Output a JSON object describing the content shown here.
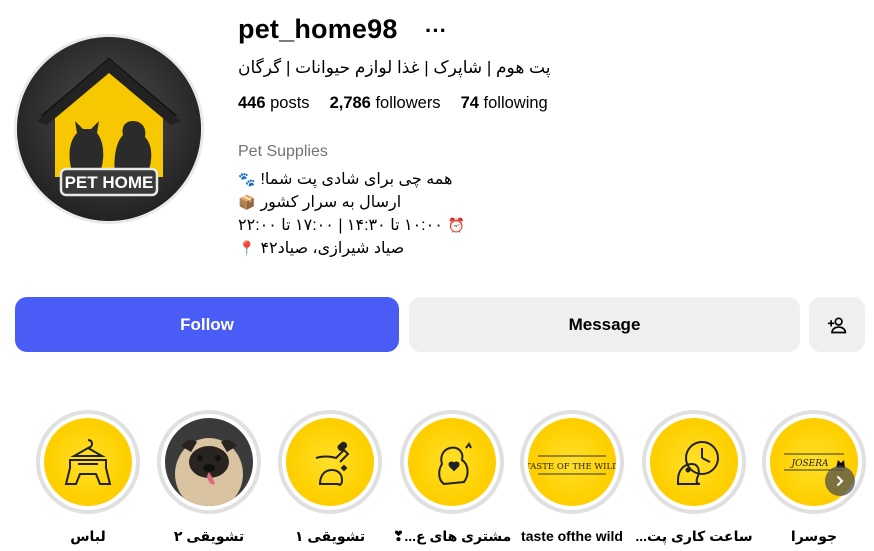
{
  "profile": {
    "username": "pet_home98",
    "more_label": "···",
    "full_name": "پت هوم | شاپرک | غذا لوازم حیوانات | گرگان",
    "stats": {
      "posts_count": "446",
      "posts_label": "posts",
      "followers_count": "2,786",
      "followers_label": "followers",
      "following_count": "74",
      "following_label": "following"
    },
    "category": "Pet Supplies",
    "bio": [
      {
        "text": "همه چی برای شادی پت شما!",
        "icon": "paw-prints-icon"
      },
      {
        "text": "ارسال به سرار کشور",
        "icon": "package-icon"
      },
      {
        "text": "۱۰:۰۰ تا ۱۴:۳۰ | ۱۷:۰۰ تا ۲۲:۰۰",
        "icon": "alarm-clock-icon"
      },
      {
        "text": "صیاد شیرازی، صیاد۴۲",
        "icon": "round-pushpin-icon"
      }
    ],
    "avatar_text": "PET HOME"
  },
  "actions": {
    "follow_label": "Follow",
    "message_label": "Message",
    "add_user_icon": "add-person-icon",
    "follow_color": "#4a5cf6"
  },
  "highlights": [
    {
      "label": "جوسرا",
      "thumb_text": "JOSERA"
    },
    {
      "label": "ساعت کاری پت...",
      "thumb_text": ""
    },
    {
      "label": "taste ofthe wild",
      "thumb_text": "TASTE OF THE WILD"
    },
    {
      "label": "مشتری های ع...❣",
      "thumb_text": ""
    },
    {
      "label": "تشویقی ۱",
      "thumb_text": ""
    },
    {
      "label": "تشویقی ۲",
      "thumb_text": ""
    },
    {
      "label": "لباس",
      "thumb_text": ""
    }
  ],
  "colors": {
    "highlight_yellow": "#ffd000",
    "avatar_dark": "#2a2a2a"
  }
}
